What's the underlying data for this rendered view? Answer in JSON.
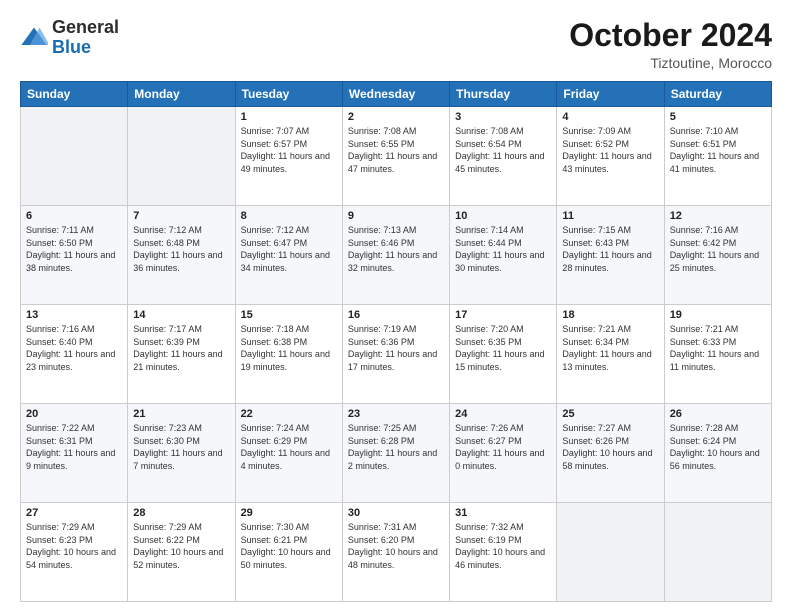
{
  "header": {
    "logo_line1": "General",
    "logo_line2": "Blue",
    "month": "October 2024",
    "location": "Tiztoutine, Morocco"
  },
  "days_of_week": [
    "Sunday",
    "Monday",
    "Tuesday",
    "Wednesday",
    "Thursday",
    "Friday",
    "Saturday"
  ],
  "weeks": [
    [
      {
        "day": "",
        "empty": true
      },
      {
        "day": "",
        "empty": true
      },
      {
        "day": "1",
        "sunrise": "7:07 AM",
        "sunset": "6:57 PM",
        "daylight": "11 hours and 49 minutes."
      },
      {
        "day": "2",
        "sunrise": "7:08 AM",
        "sunset": "6:55 PM",
        "daylight": "11 hours and 47 minutes."
      },
      {
        "day": "3",
        "sunrise": "7:08 AM",
        "sunset": "6:54 PM",
        "daylight": "11 hours and 45 minutes."
      },
      {
        "day": "4",
        "sunrise": "7:09 AM",
        "sunset": "6:52 PM",
        "daylight": "11 hours and 43 minutes."
      },
      {
        "day": "5",
        "sunrise": "7:10 AM",
        "sunset": "6:51 PM",
        "daylight": "11 hours and 41 minutes."
      }
    ],
    [
      {
        "day": "6",
        "sunrise": "7:11 AM",
        "sunset": "6:50 PM",
        "daylight": "11 hours and 38 minutes."
      },
      {
        "day": "7",
        "sunrise": "7:12 AM",
        "sunset": "6:48 PM",
        "daylight": "11 hours and 36 minutes."
      },
      {
        "day": "8",
        "sunrise": "7:12 AM",
        "sunset": "6:47 PM",
        "daylight": "11 hours and 34 minutes."
      },
      {
        "day": "9",
        "sunrise": "7:13 AM",
        "sunset": "6:46 PM",
        "daylight": "11 hours and 32 minutes."
      },
      {
        "day": "10",
        "sunrise": "7:14 AM",
        "sunset": "6:44 PM",
        "daylight": "11 hours and 30 minutes."
      },
      {
        "day": "11",
        "sunrise": "7:15 AM",
        "sunset": "6:43 PM",
        "daylight": "11 hours and 28 minutes."
      },
      {
        "day": "12",
        "sunrise": "7:16 AM",
        "sunset": "6:42 PM",
        "daylight": "11 hours and 25 minutes."
      }
    ],
    [
      {
        "day": "13",
        "sunrise": "7:16 AM",
        "sunset": "6:40 PM",
        "daylight": "11 hours and 23 minutes."
      },
      {
        "day": "14",
        "sunrise": "7:17 AM",
        "sunset": "6:39 PM",
        "daylight": "11 hours and 21 minutes."
      },
      {
        "day": "15",
        "sunrise": "7:18 AM",
        "sunset": "6:38 PM",
        "daylight": "11 hours and 19 minutes."
      },
      {
        "day": "16",
        "sunrise": "7:19 AM",
        "sunset": "6:36 PM",
        "daylight": "11 hours and 17 minutes."
      },
      {
        "day": "17",
        "sunrise": "7:20 AM",
        "sunset": "6:35 PM",
        "daylight": "11 hours and 15 minutes."
      },
      {
        "day": "18",
        "sunrise": "7:21 AM",
        "sunset": "6:34 PM",
        "daylight": "11 hours and 13 minutes."
      },
      {
        "day": "19",
        "sunrise": "7:21 AM",
        "sunset": "6:33 PM",
        "daylight": "11 hours and 11 minutes."
      }
    ],
    [
      {
        "day": "20",
        "sunrise": "7:22 AM",
        "sunset": "6:31 PM",
        "daylight": "11 hours and 9 minutes."
      },
      {
        "day": "21",
        "sunrise": "7:23 AM",
        "sunset": "6:30 PM",
        "daylight": "11 hours and 7 minutes."
      },
      {
        "day": "22",
        "sunrise": "7:24 AM",
        "sunset": "6:29 PM",
        "daylight": "11 hours and 4 minutes."
      },
      {
        "day": "23",
        "sunrise": "7:25 AM",
        "sunset": "6:28 PM",
        "daylight": "11 hours and 2 minutes."
      },
      {
        "day": "24",
        "sunrise": "7:26 AM",
        "sunset": "6:27 PM",
        "daylight": "11 hours and 0 minutes."
      },
      {
        "day": "25",
        "sunrise": "7:27 AM",
        "sunset": "6:26 PM",
        "daylight": "10 hours and 58 minutes."
      },
      {
        "day": "26",
        "sunrise": "7:28 AM",
        "sunset": "6:24 PM",
        "daylight": "10 hours and 56 minutes."
      }
    ],
    [
      {
        "day": "27",
        "sunrise": "7:29 AM",
        "sunset": "6:23 PM",
        "daylight": "10 hours and 54 minutes."
      },
      {
        "day": "28",
        "sunrise": "7:29 AM",
        "sunset": "6:22 PM",
        "daylight": "10 hours and 52 minutes."
      },
      {
        "day": "29",
        "sunrise": "7:30 AM",
        "sunset": "6:21 PM",
        "daylight": "10 hours and 50 minutes."
      },
      {
        "day": "30",
        "sunrise": "7:31 AM",
        "sunset": "6:20 PM",
        "daylight": "10 hours and 48 minutes."
      },
      {
        "day": "31",
        "sunrise": "7:32 AM",
        "sunset": "6:19 PM",
        "daylight": "10 hours and 46 minutes."
      },
      {
        "day": "",
        "empty": true
      },
      {
        "day": "",
        "empty": true
      }
    ]
  ]
}
